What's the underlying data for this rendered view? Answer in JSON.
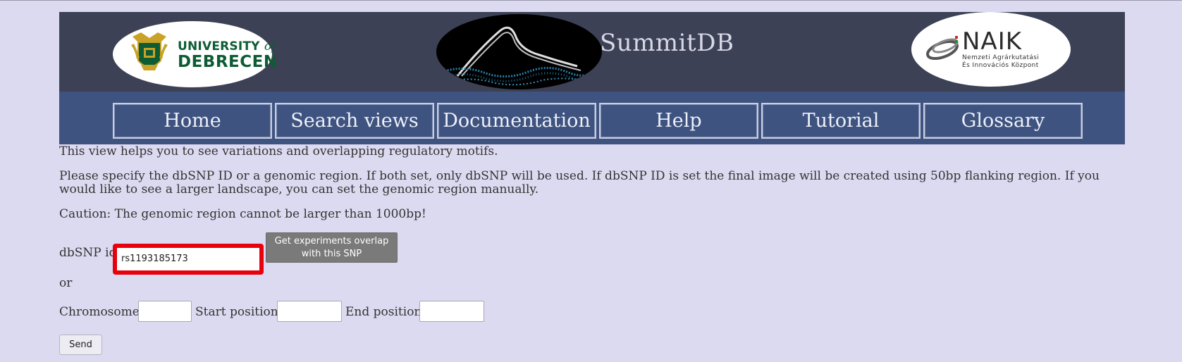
{
  "header": {
    "university_logo": {
      "line1": "UNIVERSITY",
      "line1_of": "of",
      "line2": "DEBRECEN"
    },
    "app_logo": {
      "title": "SummitDB"
    },
    "partner_logo": {
      "word": "NAIK",
      "sub1": "Nemzeti Agrárkutatási",
      "sub2": "És Innovációs Központ"
    }
  },
  "nav": {
    "items": [
      {
        "label": "Home"
      },
      {
        "label": "Search views"
      },
      {
        "label": "Documentation"
      },
      {
        "label": "Help"
      },
      {
        "label": "Tutorial"
      },
      {
        "label": "Glossary"
      }
    ]
  },
  "main": {
    "intro": "This view helps you to see variations and overlapping regulatory motifs.",
    "description": "Please specify the dbSNP ID or a genomic region. If both set, only dbSNP will be used. If dbSNP ID is set the final image will be created using 50bp flanking region. If you would like to see a larger landscape, you can set the genomic region manually.",
    "caution": "Caution: The genomic region cannot be larger than 1000bp!",
    "snp": {
      "label": "dbSNP id:",
      "value": "rs1193185173",
      "button_label": "Get experiments overlap with this SNP"
    },
    "or_label": "or",
    "region": {
      "chromosome_label": "Chromosome:",
      "chromosome_value": "",
      "start_label": "Start position:",
      "start_value": "",
      "end_label": "End position:",
      "end_value": ""
    },
    "send_label": "Send"
  },
  "colors": {
    "page_bg": "#dcdaf0",
    "banner_bg": "#3c4156",
    "nav_bg": "#3e5380",
    "highlight": "#e8000c",
    "button_gray": "#7a7a7a"
  }
}
